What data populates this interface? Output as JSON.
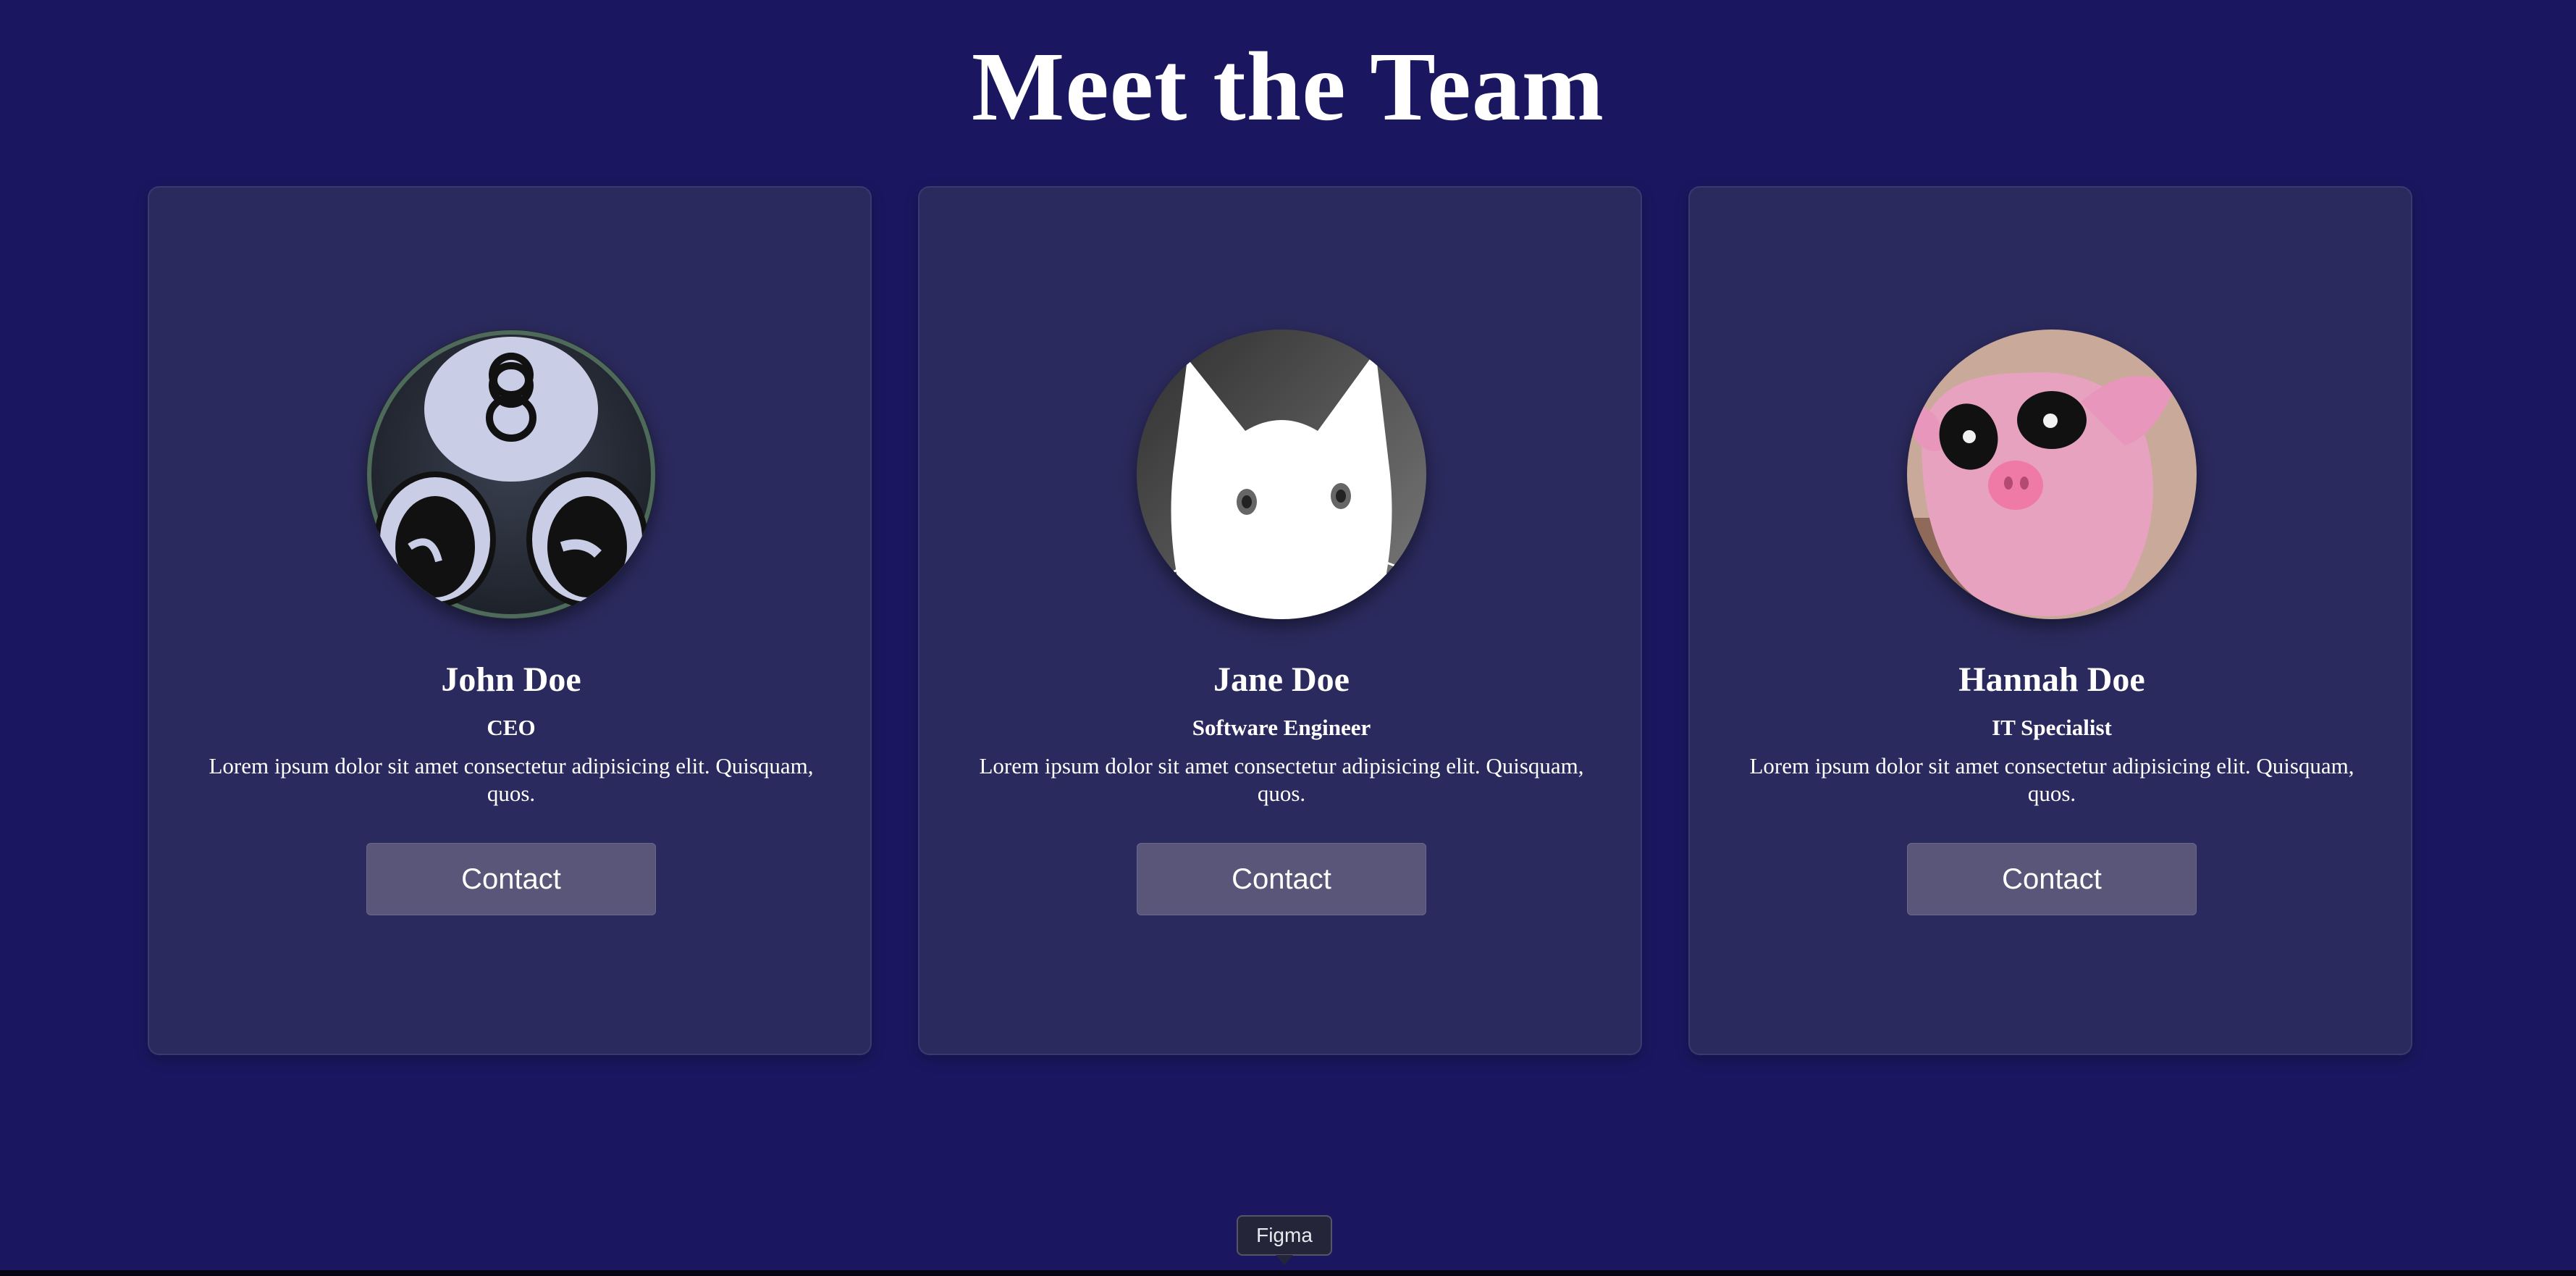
{
  "page": {
    "title": "Meet the Team",
    "background_color": "#1a1760"
  },
  "team": [
    {
      "name": "John Doe",
      "role": "CEO",
      "bio": "Lorem ipsum dolor sit amet consectetur adipisicing elit. Quisquam, quos.",
      "contact_label": "Contact",
      "avatar_icon": "eight-ball-avatar-icon"
    },
    {
      "name": "Jane Doe",
      "role": "Software Engineer",
      "bio": "Lorem ipsum dolor sit amet consectetur adipisicing elit. Quisquam, quos.",
      "contact_label": "Contact",
      "avatar_icon": "white-cat-avatar-icon"
    },
    {
      "name": "Hannah Doe",
      "role": "IT Specialist",
      "bio": "Lorem ipsum dolor sit amet consectetur adipisicing elit. Quisquam, quos.",
      "contact_label": "Contact",
      "avatar_icon": "pink-pig-avatar-icon"
    }
  ],
  "tooltip": {
    "label": "Figma"
  },
  "colors": {
    "card_background": "#2b2a5e",
    "button_background": "#5a5679",
    "text": "#ffffff"
  }
}
